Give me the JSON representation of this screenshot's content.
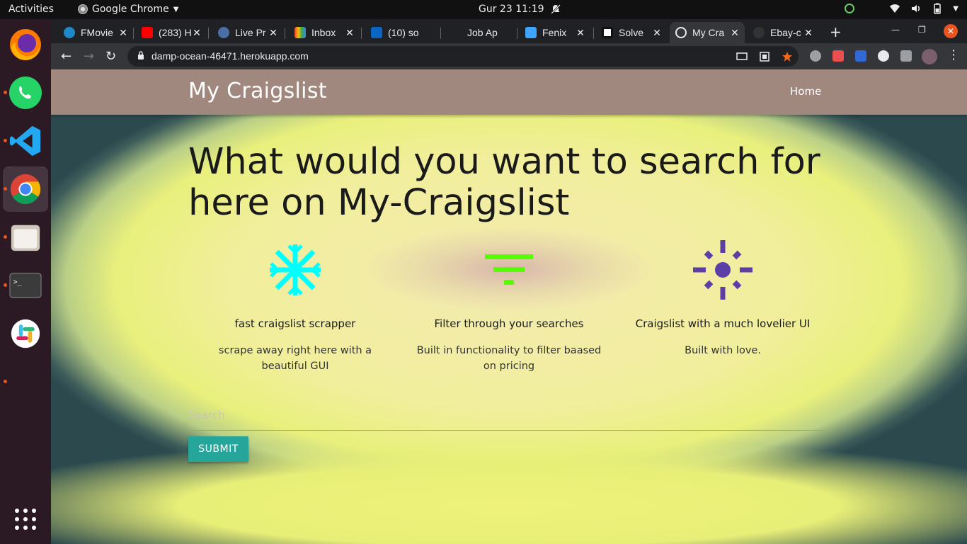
{
  "topbar": {
    "activities": "Activities",
    "app_name": "Google Chrome",
    "clock": "Gur 23  11:19"
  },
  "browser": {
    "tabs": [
      {
        "title": "FMovie",
        "icon": "fmovies-icon"
      },
      {
        "title": "(283) H",
        "icon": "youtube-icon"
      },
      {
        "title": "Live Pr",
        "icon": "live-icon"
      },
      {
        "title": "Inbox",
        "icon": "gmail-icon"
      },
      {
        "title": "(10) so",
        "icon": "linkedin-icon"
      },
      {
        "title": "Job Ap",
        "icon": "job-icon"
      },
      {
        "title": "Fenix",
        "icon": "fenix-icon"
      },
      {
        "title": "Solve",
        "icon": "hackerrank-icon"
      },
      {
        "title": "My Cra",
        "icon": "globe-icon",
        "active": true
      },
      {
        "title": "Ebay-c",
        "icon": "github-icon"
      }
    ],
    "url": "damp-ocean-46471.herokuapp.com"
  },
  "site": {
    "brand": "My Craigslist",
    "nav_home": "Home",
    "hero": "What would you want to search for here on My-Craigslist",
    "features": [
      {
        "icon": "snowflake-icon",
        "color": "#00ffff",
        "title": "fast craigslist scrapper",
        "text": "scrape away right here with a beautiful GUI"
      },
      {
        "icon": "filter-icon",
        "color": "#55ff00",
        "title": "Filter through your searches",
        "text": "Built in functionality to filter baased on pricing"
      },
      {
        "icon": "sun-icon",
        "color": "#5b3fa6",
        "title": "Craigslist with a much lovelier UI",
        "text": "Built with love."
      }
    ],
    "search": {
      "placeholder": "Search",
      "value": ""
    },
    "submit_label": "SUBMIT"
  },
  "colors": {
    "navbar": "#a1887f",
    "button": "#26a69a",
    "dock": "#2b1a24",
    "accent": "#e95420"
  }
}
